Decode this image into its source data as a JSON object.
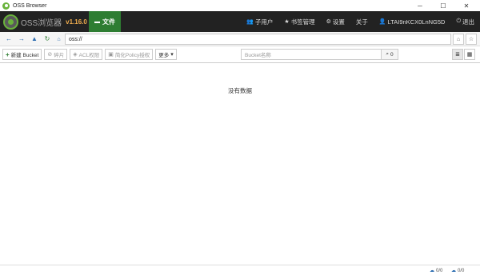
{
  "window": {
    "title": "OSS Browser",
    "minimize": "─",
    "maximize": "☐",
    "close": "✕"
  },
  "nav": {
    "logo_text": "OSS浏览器",
    "version": "v1.16.0",
    "files_label": "文件",
    "items": [
      {
        "label": "子用户",
        "icon": "users-icon",
        "glyph": "👥"
      },
      {
        "label": "书签管理",
        "icon": "star-icon",
        "glyph": "★"
      },
      {
        "label": "设置",
        "icon": "gear-icon",
        "glyph": "⚙"
      },
      {
        "label": "关于",
        "icon": "",
        "glyph": ""
      },
      {
        "label": "LTAI9nKCX0LnNG5D",
        "icon": "user-icon",
        "glyph": "👤"
      },
      {
        "label": "退出",
        "icon": "power-icon",
        "glyph": "⏻"
      }
    ]
  },
  "address": {
    "value": "oss://"
  },
  "toolbar": {
    "new_bucket": "新建 Bucket",
    "fragments": "碎片",
    "acl": "ACL权限",
    "policy": "简化Policy授权",
    "more": "更多",
    "search_placeholder": "Bucket名称",
    "search_count": "0"
  },
  "content": {
    "empty_text": "没有数据"
  },
  "footer": {
    "upload": "0/0",
    "download": "0/0"
  },
  "colors": {
    "nav_bg": "#222222",
    "files_active": "#2e7d32",
    "version": "#f0ad4e",
    "accent": "#2b6cb0"
  }
}
